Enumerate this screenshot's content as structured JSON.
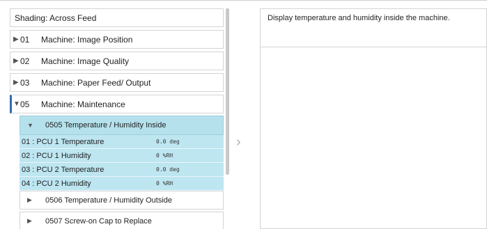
{
  "header": {
    "label": "Shading: Across Feed"
  },
  "categories": [
    {
      "tri": "▶",
      "num": "01",
      "label": "Machine: Image Position"
    },
    {
      "tri": "▶",
      "num": "02",
      "label": "Machine: Image Quality"
    },
    {
      "tri": "▶",
      "num": "03",
      "label": "Machine: Paper Feed/ Output"
    },
    {
      "tri": "▼",
      "num": "05",
      "label": "Machine: Maintenance"
    }
  ],
  "subgroups": [
    {
      "tri": "▼",
      "label": "0505 Temperature / Humidity Inside"
    },
    {
      "tri": "▶",
      "label": "0506 Temperature / Humidity Outside"
    },
    {
      "tri": "▶",
      "label": "0507 Screw-on Cap to Replace"
    }
  ],
  "items": [
    {
      "name": "01 : PCU 1 Temperature",
      "value": "0.0 deg"
    },
    {
      "name": "02 : PCU 1 Humidity",
      "value": "0 %RH"
    },
    {
      "name": "03 : PCU 2 Temperature",
      "value": "0.0 deg"
    },
    {
      "name": "04 : PCU 2 Humidity",
      "value": "0 %RH"
    }
  ],
  "nav": {
    "chevron": "›"
  },
  "description": "Display temperature and humidity inside the machine."
}
